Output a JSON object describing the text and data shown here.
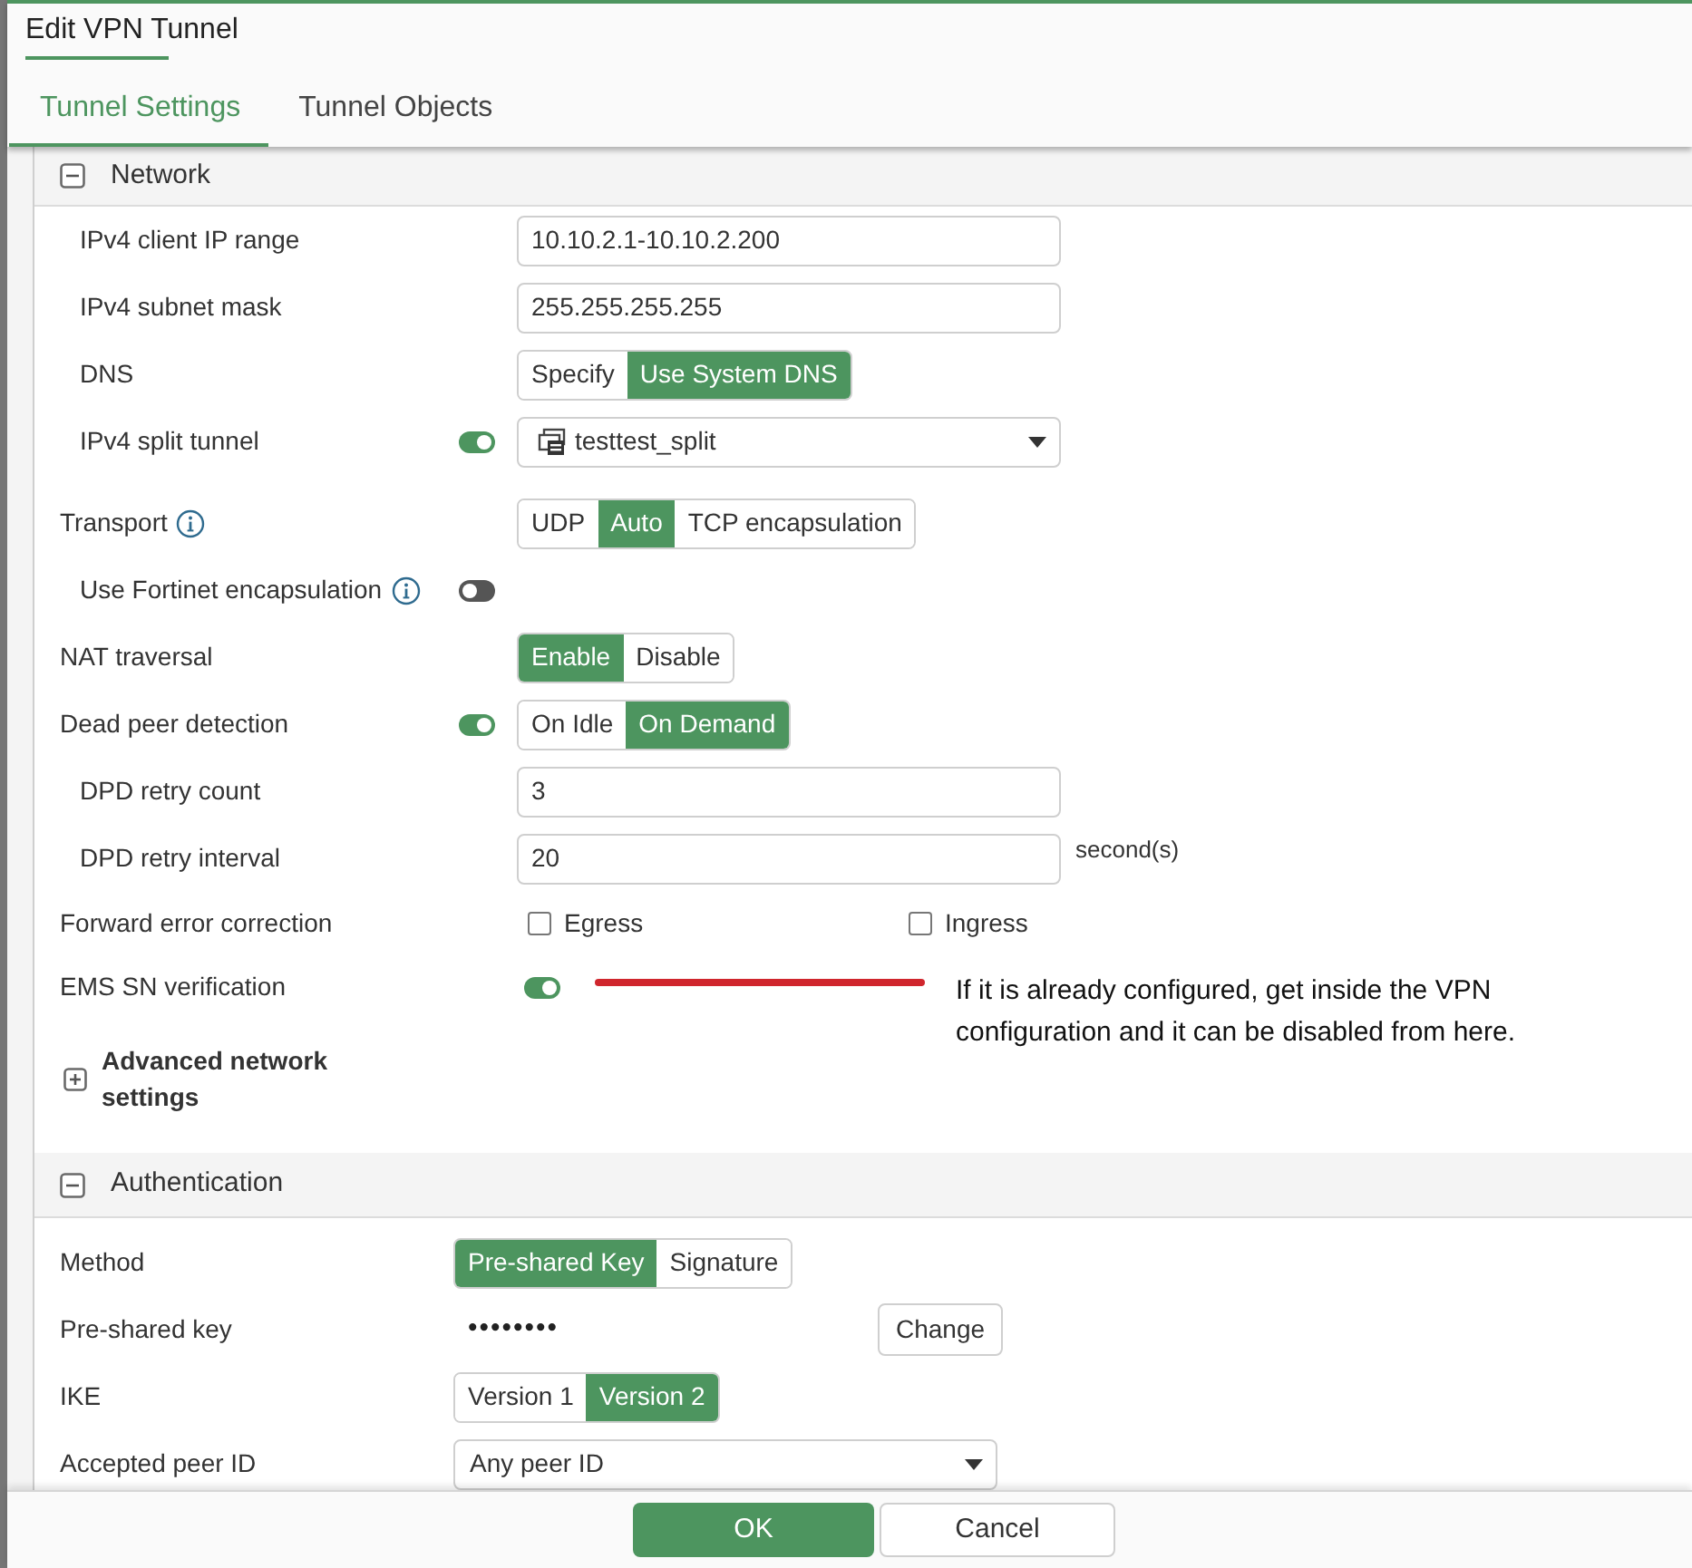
{
  "window": {
    "title": "Edit VPN Tunnel"
  },
  "tabs": [
    {
      "label": "Tunnel Settings",
      "selected": true
    },
    {
      "label": "Tunnel Objects",
      "selected": false
    }
  ],
  "sections": [
    {
      "title": "Network",
      "expanded": true,
      "rows": [
        {
          "kind": "group",
          "children": [
            {
              "kind": "text",
              "label": "IPv4 client IP range",
              "value": "10.10.2.1-10.10.2.200"
            },
            {
              "kind": "text",
              "label": "IPv4 subnet mask",
              "value": "255.255.255.255"
            },
            {
              "kind": "segmented",
              "label": "DNS",
              "options": [
                {
                  "label": "Specify",
                  "selected": false
                },
                {
                  "label": "Use System DNS",
                  "selected": true
                }
              ]
            },
            {
              "kind": "select",
              "label": "IPv4 split tunnel",
              "switch": {
                "on": true
              },
              "value_icon": true,
              "value": "testtest_split"
            }
          ]
        },
        {
          "kind": "segmented",
          "label": "Transport",
          "info": true,
          "options": [
            {
              "label": "UDP",
              "selected": false
            },
            {
              "label": "Auto",
              "selected": true
            },
            {
              "label": "TCP encapsulation",
              "selected": false
            }
          ],
          "children": [
            {
              "kind": "label",
              "label": "Use Fortinet encapsulation",
              "info": true,
              "switch": {
                "on": false
              }
            }
          ]
        },
        {
          "kind": "segmented",
          "label": "NAT traversal",
          "options": [
            {
              "label": "Enable",
              "selected": true
            },
            {
              "label": "Disable",
              "selected": false
            }
          ]
        },
        {
          "kind": "segmented",
          "label": "Dead peer detection",
          "switch": {
            "on": true
          },
          "options": [
            {
              "label": "On Idle",
              "selected": false
            },
            {
              "label": "On Demand",
              "selected": true
            }
          ],
          "children": [
            {
              "kind": "text",
              "label": "DPD retry count",
              "value": "3"
            },
            {
              "kind": "text",
              "label": "DPD retry interval",
              "value": "20",
              "unit": "second(s)"
            }
          ]
        },
        {
          "kind": "checkboxes",
          "label": "Forward error correction",
          "options": [
            {
              "label": "Egress",
              "checked": false
            },
            {
              "label": "Ingress",
              "checked": false
            }
          ]
        },
        {
          "kind": "switch",
          "label": "EMS SN verification",
          "on": true,
          "note": "If it is already configured, get inside the VPN configuration and it can be disabled from here."
        },
        {
          "kind": "expander",
          "label": "Advanced network settings",
          "expanded": false
        }
      ]
    },
    {
      "title": "Authentication",
      "expanded": true,
      "rows": [
        {
          "kind": "segmented",
          "label": "Method",
          "options": [
            {
              "label": "Pre-shared Key",
              "selected": true
            },
            {
              "label": "Signature",
              "selected": false
            }
          ]
        },
        {
          "kind": "password",
          "label": "Pre-shared key",
          "value": "••••••••",
          "button": "Change"
        },
        {
          "kind": "segmented",
          "label": "IKE",
          "options": [
            {
              "label": "Version 1",
              "selected": false
            },
            {
              "label": "Version 2",
              "selected": true
            }
          ]
        },
        {
          "kind": "select",
          "label": "Accepted peer ID",
          "value": "Any peer ID"
        }
      ]
    }
  ],
  "buttons": [
    {
      "label": "OK",
      "kind": "primary"
    },
    {
      "label": "Cancel",
      "kind": "secondary"
    }
  ]
}
